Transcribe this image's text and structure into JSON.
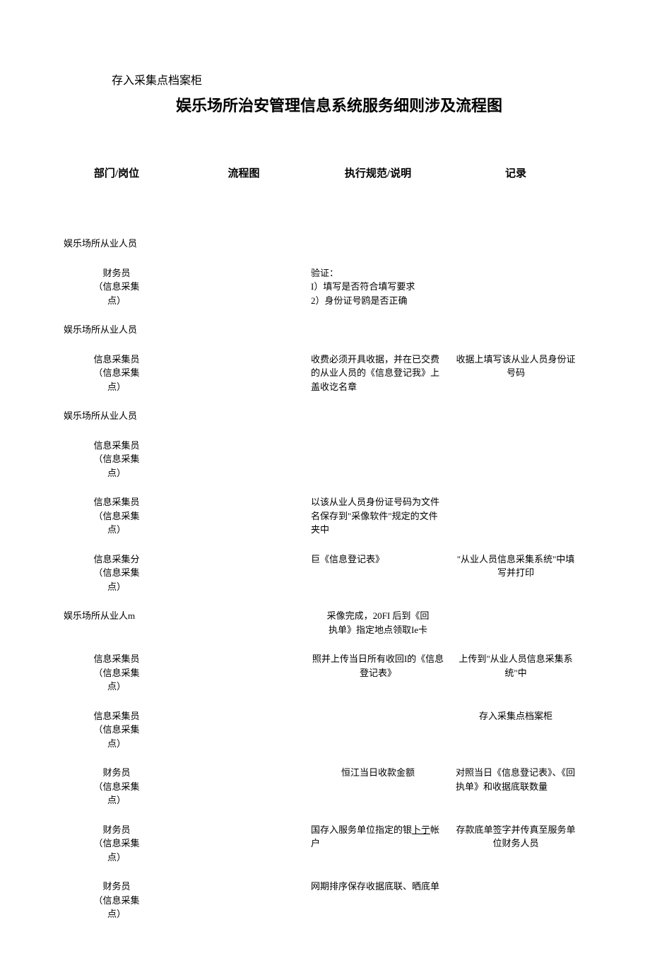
{
  "preTitle": "存入采集点档案柜",
  "mainTitle": "娱乐场所治安管理信息系统服务细则涉及流程图",
  "headers": {
    "col1": "部门/岗位",
    "col2": "流程图",
    "col3": "执行规范/说明",
    "col4": "记录"
  },
  "rows": [
    {
      "col1": "娱乐场所从业人员",
      "col1Align": "left",
      "col3": "",
      "col4": ""
    },
    {
      "col1": "财务员\n（信息采集\n点）",
      "col3": "验证：\nI）填写是否符合填写要求\n2）身份证号鸥是否正确",
      "col4": ""
    },
    {
      "col1": "娱乐场所从业人员",
      "col1Align": "left",
      "col3": "",
      "col4": ""
    },
    {
      "col1": "信息采集员\n（信息采集\n点）",
      "col3": "收费必须开具收据，并在已交费的从业人员的《信息登记我》上盖收讫名章",
      "col4": "收据上填写该从业人员身份证号码"
    },
    {
      "col1": "娱乐场所从业人员",
      "col1Align": "left",
      "col3": "",
      "col4": ""
    },
    {
      "col1": "信息采集员\n（信息采集\n点）",
      "col3": "",
      "col4": ""
    },
    {
      "col1": "信息采集员\n（信息采集\n点）",
      "col3": "以该从业人员身份证号码为文件名保存到\"采像软件\"规定的文件夹中",
      "col4": ""
    },
    {
      "col1": "信息采集分\n（信息采集\n点）",
      "col3": "巨《信息登记表》",
      "col4": "\"从业人员信息采集系统\"中填写并打印"
    },
    {
      "col1": "娱乐场所从业人m",
      "col1Align": "left",
      "col3": "采像完成，20FI 后到《回\n执单》指定地点领取Ie卡",
      "col3Center": true,
      "col4": ""
    },
    {
      "col1": "信息采集员\n（信息采集\n点）",
      "col3": "照并上传当日所有收回I的《信息登记表》",
      "col3Center": true,
      "col4": "上传到\"从业人员信息采集系统\"中"
    },
    {
      "col1": "信息采集员\n（信息采集\n点）",
      "col3": "",
      "col4": "存入采集点档案柜"
    },
    {
      "col1": "财务员\n（信息采集\n点）",
      "col3": "恒江当日收款金额",
      "col3Center": true,
      "col4": "对照当日《信息登记表》、《回执单》和收据底联数量",
      "col4Left": true
    },
    {
      "col1": "财务员\n（信息采集\n点）",
      "col3": "国存入服务单位指定的银<u>卜亍</u>帐户",
      "col3Html": true,
      "col4": "存款底单签字并传真至服务单位财务人员"
    },
    {
      "col1": "财务员\n（信息采集\n点）",
      "col3": "网期排序保存收据底联、晒底单",
      "col4": ""
    }
  ]
}
